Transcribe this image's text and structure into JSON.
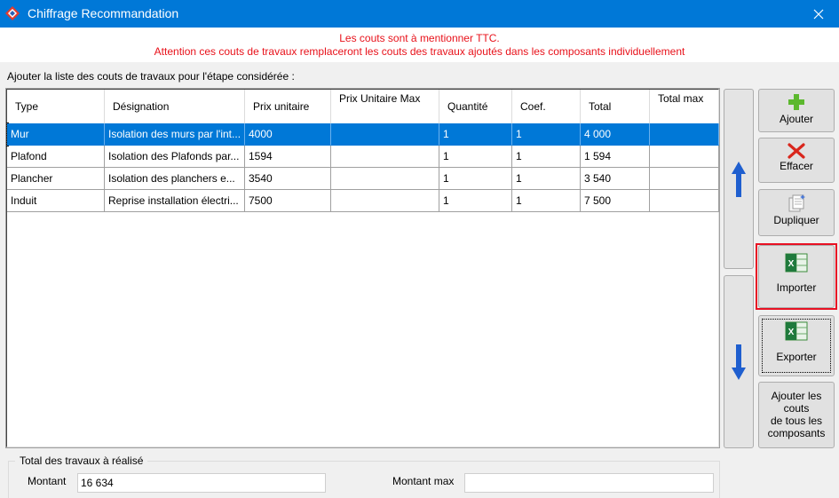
{
  "window": {
    "title": "Chiffrage Recommandation"
  },
  "warning": {
    "line1": "Les couts sont à mentionner TTC.",
    "line2": "Attention ces couts de travaux remplaceront les couts des travaux ajoutés dans les composants individuellement"
  },
  "list_caption": "Ajouter la liste des couts de travaux pour l'étape considérée :",
  "table": {
    "columns": [
      "Type",
      "Désignation",
      "Prix unitaire",
      "Prix Unitaire Max",
      "Quantité",
      "Coef.",
      "Total",
      "Total max"
    ],
    "rows": [
      {
        "type": "Mur",
        "designation": "Isolation des murs par l'int...",
        "prix_unitaire": "4000",
        "prix_unitaire_max": "",
        "quantite": "1",
        "coef": "1",
        "total": "4 000",
        "total_max": ""
      },
      {
        "type": "Plafond",
        "designation": "Isolation des Plafonds par...",
        "prix_unitaire": "1594",
        "prix_unitaire_max": "",
        "quantite": "1",
        "coef": "1",
        "total": "1 594",
        "total_max": ""
      },
      {
        "type": "Plancher",
        "designation": "Isolation des planchers e...",
        "prix_unitaire": "3540",
        "prix_unitaire_max": "",
        "quantite": "1",
        "coef": "1",
        "total": "3 540",
        "total_max": ""
      },
      {
        "type": "Induit",
        "designation": "Reprise installation électri...",
        "prix_unitaire": "7500",
        "prix_unitaire_max": "",
        "quantite": "1",
        "coef": "1",
        "total": "7 500",
        "total_max": ""
      }
    ]
  },
  "buttons": {
    "ajouter": "Ajouter",
    "effacer": "Effacer",
    "dupliquer": "Dupliquer",
    "importer": "Importer",
    "exporter": "Exporter",
    "ajouter_couts_1": "Ajouter les",
    "ajouter_couts_2": "couts",
    "ajouter_couts_3": "de tous les",
    "ajouter_couts_4": "composants"
  },
  "totals": {
    "group_title": "Total des travaux à réalisé",
    "montant_label": "Montant",
    "montant_value": "16 634",
    "montant_max_label": "Montant max",
    "montant_max_value": ""
  },
  "icons": {
    "app": "app-logo-icon",
    "close": "close-icon",
    "up": "arrow-up-icon",
    "down": "arrow-down-icon",
    "add": "plus-icon",
    "delete": "red-x-icon",
    "duplicate": "copy-icon",
    "excel": "excel-icon"
  },
  "colors": {
    "titlebar": "#0078d7",
    "warning_text": "#e8111a",
    "selection": "#0078d7",
    "highlight": "#e81123"
  }
}
